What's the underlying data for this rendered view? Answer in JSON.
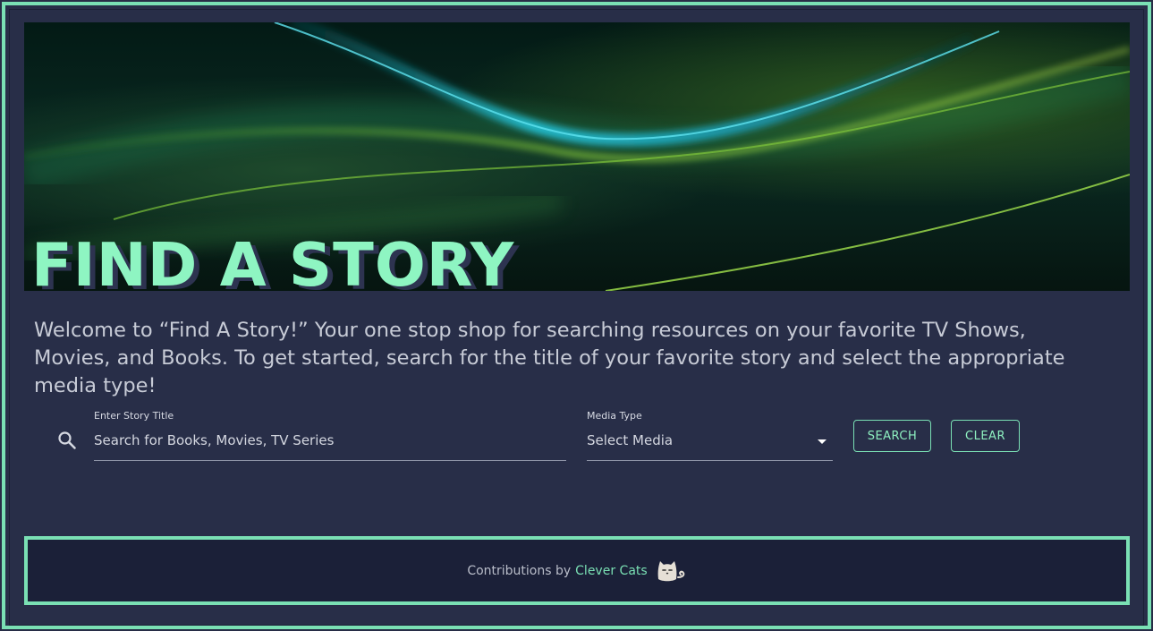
{
  "hero": {
    "title": "FIND A STORY"
  },
  "welcome_text": "Welcome to “Find A Story!” Your one stop shop for searching resources on your favorite TV Shows, Movies, and Books. To get started, search for the title of your favorite story and select the appropriate media type!",
  "search": {
    "label": "Enter Story Title",
    "placeholder": "Search for Books, Movies, TV Series",
    "icon": "search-icon"
  },
  "media": {
    "label": "Media Type",
    "selected": "Select Media",
    "icon": "caret-down-icon"
  },
  "buttons": {
    "search": "SEARCH",
    "clear": "CLEAR"
  },
  "footer": {
    "prefix": "Contributions by",
    "brand": "Clever Cats",
    "icon": "cat-icon"
  },
  "colors": {
    "accent": "#7ae0b4",
    "title": "#8ef5c2",
    "background": "#282e48",
    "footer_bg": "#1b2038"
  }
}
